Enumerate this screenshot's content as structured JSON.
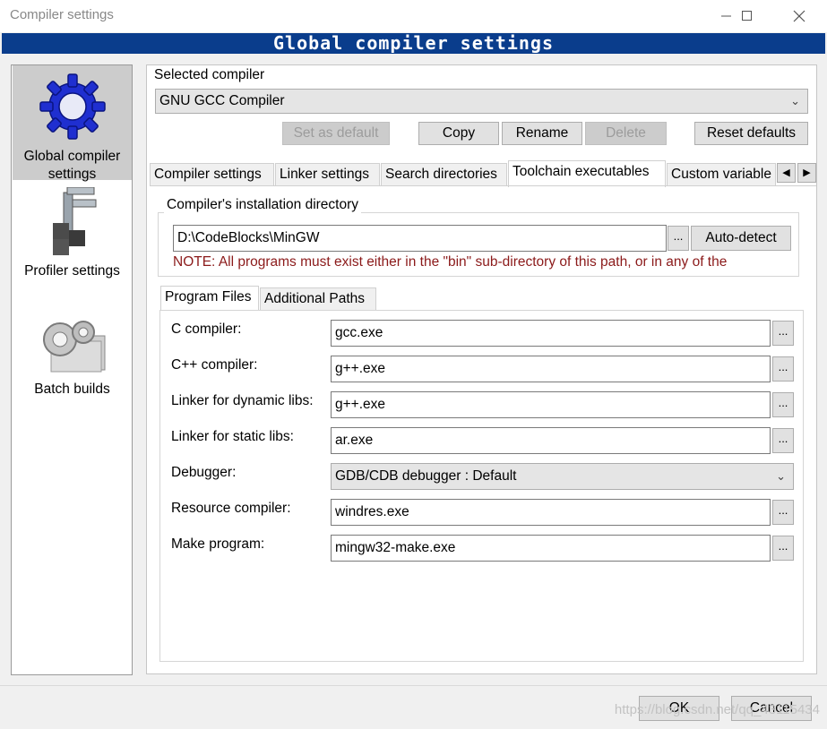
{
  "window": {
    "title": "Compiler settings",
    "banner": "Global compiler settings"
  },
  "sidebar": {
    "items": [
      {
        "label_line1": "Global compiler",
        "label_line2": "settings",
        "icon": "gear-icon",
        "selected": true
      },
      {
        "label": "Profiler settings",
        "icon": "caliper-icon"
      },
      {
        "label": "Batch builds",
        "icon": "batch-gears-icon"
      }
    ]
  },
  "compiler": {
    "group_label": "Selected compiler",
    "selected": "GNU GCC Compiler",
    "buttons": {
      "set_default": "Set as default",
      "copy": "Copy",
      "rename": "Rename",
      "delete": "Delete",
      "reset": "Reset defaults"
    }
  },
  "tabs": [
    "Compiler settings",
    "Linker settings",
    "Search directories",
    "Toolchain executables",
    "Custom variable"
  ],
  "active_tab": "Toolchain executables",
  "install_dir": {
    "label": "Compiler's installation directory",
    "value": "D:\\CodeBlocks\\MinGW",
    "browse": "...",
    "autodetect": "Auto-detect",
    "note": "NOTE: All programs must exist either in the \"bin\" sub-directory of this path, or in any of the"
  },
  "subtabs": [
    "Program Files",
    "Additional Paths"
  ],
  "programs": [
    {
      "label": "C compiler:",
      "value": "gcc.exe",
      "type": "text"
    },
    {
      "label": "C++ compiler:",
      "value": "g++.exe",
      "type": "text"
    },
    {
      "label": "Linker for dynamic libs:",
      "value": "g++.exe",
      "type": "text"
    },
    {
      "label": "Linker for static libs:",
      "value": "ar.exe",
      "type": "text"
    },
    {
      "label": "Debugger:",
      "value": "GDB/CDB debugger : Default",
      "type": "select"
    },
    {
      "label": "Resource compiler:",
      "value": "windres.exe",
      "type": "text"
    },
    {
      "label": "Make program:",
      "value": "mingw32-make.exe",
      "type": "text"
    }
  ],
  "dialog_buttons": {
    "ok": "OK",
    "cancel": "Cancel"
  },
  "watermark": "https://blog.csdn.net/qq_43115434",
  "colors": {
    "banner_bg": "#0a3d8c",
    "note_text": "#8b1a1a"
  }
}
